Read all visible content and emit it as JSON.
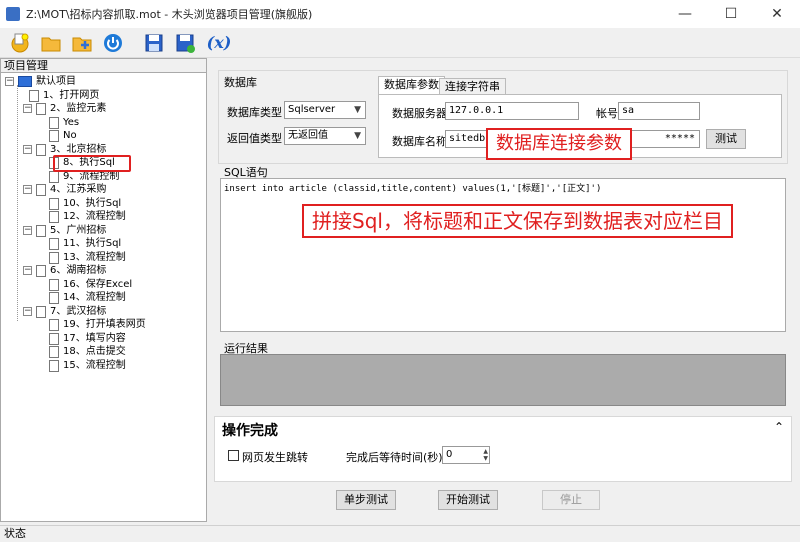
{
  "window": {
    "title": "Z:\\MOT\\招标内容抓取.mot - 木头浏览器项目管理(旗舰版)",
    "minimize": "—",
    "maximize": "☐",
    "close": "✕"
  },
  "toolbar": {
    "icons": [
      "new-project-icon",
      "open-folder-icon",
      "add-folder-icon",
      "power-icon",
      "save-icon",
      "save-as-icon",
      "variable-icon"
    ],
    "variable_label": "(x)"
  },
  "tree": {
    "header": "项目管理",
    "items": [
      {
        "label": "默认项目",
        "level": 0,
        "type": "root"
      },
      {
        "label": "1、打开网页",
        "level": 1,
        "type": "doc"
      },
      {
        "label": "2、监控元素",
        "level": 1,
        "type": "group"
      },
      {
        "label": "Yes",
        "level": 2,
        "type": "doc"
      },
      {
        "label": "No",
        "level": 2,
        "type": "doc"
      },
      {
        "label": "3、北京招标",
        "level": 1,
        "type": "group"
      },
      {
        "label": "8、执行Sql",
        "level": 2,
        "type": "doc"
      },
      {
        "label": "9、流程控制",
        "level": 2,
        "type": "doc"
      },
      {
        "label": "4、江苏采购",
        "level": 1,
        "type": "group"
      },
      {
        "label": "10、执行Sql",
        "level": 2,
        "type": "doc"
      },
      {
        "label": "12、流程控制",
        "level": 2,
        "type": "doc"
      },
      {
        "label": "5、广州招标",
        "level": 1,
        "type": "group"
      },
      {
        "label": "11、执行Sql",
        "level": 2,
        "type": "doc"
      },
      {
        "label": "13、流程控制",
        "level": 2,
        "type": "doc"
      },
      {
        "label": "6、湖南招标",
        "level": 1,
        "type": "group"
      },
      {
        "label": "16、保存Excel",
        "level": 2,
        "type": "doc"
      },
      {
        "label": "14、流程控制",
        "level": 2,
        "type": "doc"
      },
      {
        "label": "7、武汉招标",
        "level": 1,
        "type": "group"
      },
      {
        "label": "19、打开填表网页",
        "level": 2,
        "type": "doc"
      },
      {
        "label": "17、填写内容",
        "level": 2,
        "type": "doc"
      },
      {
        "label": "18、点击提交",
        "level": 2,
        "type": "doc"
      },
      {
        "label": "15、流程控制",
        "level": 2,
        "type": "doc"
      }
    ]
  },
  "database": {
    "group_label": "数据库",
    "db_type_label": "数据库类型",
    "db_type_value": "Sqlserver",
    "return_label": "返回值类型",
    "return_value": "无返回值",
    "tabs": [
      "数据库参数",
      "连接字符串"
    ],
    "server_label": "数据服务器",
    "server_value": "127.0.0.1",
    "account_label": "帐号",
    "account_value": "sa",
    "dbname_label": "数据库名称",
    "dbname_value": "sitedb",
    "password_value": "*****",
    "test_button": "测试"
  },
  "sql": {
    "group_label": "SQL语句",
    "statement": "insert into article (classid,title,content) values(1,'[标题]','[正文]')"
  },
  "result": {
    "group_label": "运行结果"
  },
  "completion": {
    "title": "操作完成",
    "collapse_glyph": "⌃",
    "redirect_label": "网页发生跳转",
    "wait_label": "完成后等待时间(秒)",
    "wait_value": "0"
  },
  "buttons": {
    "step_test": "单步测试",
    "start_test": "开始测试",
    "stop": "停止"
  },
  "annotations": {
    "db_params": "数据库连接参数",
    "sql_note": "拼接Sql，将标题和正文保存到数据表对应栏目"
  },
  "status": {
    "text": "状态"
  },
  "colors": {
    "annotation_red": "#e02020",
    "result_bg": "#ababab",
    "accent_blue": "#2e6fd8"
  }
}
